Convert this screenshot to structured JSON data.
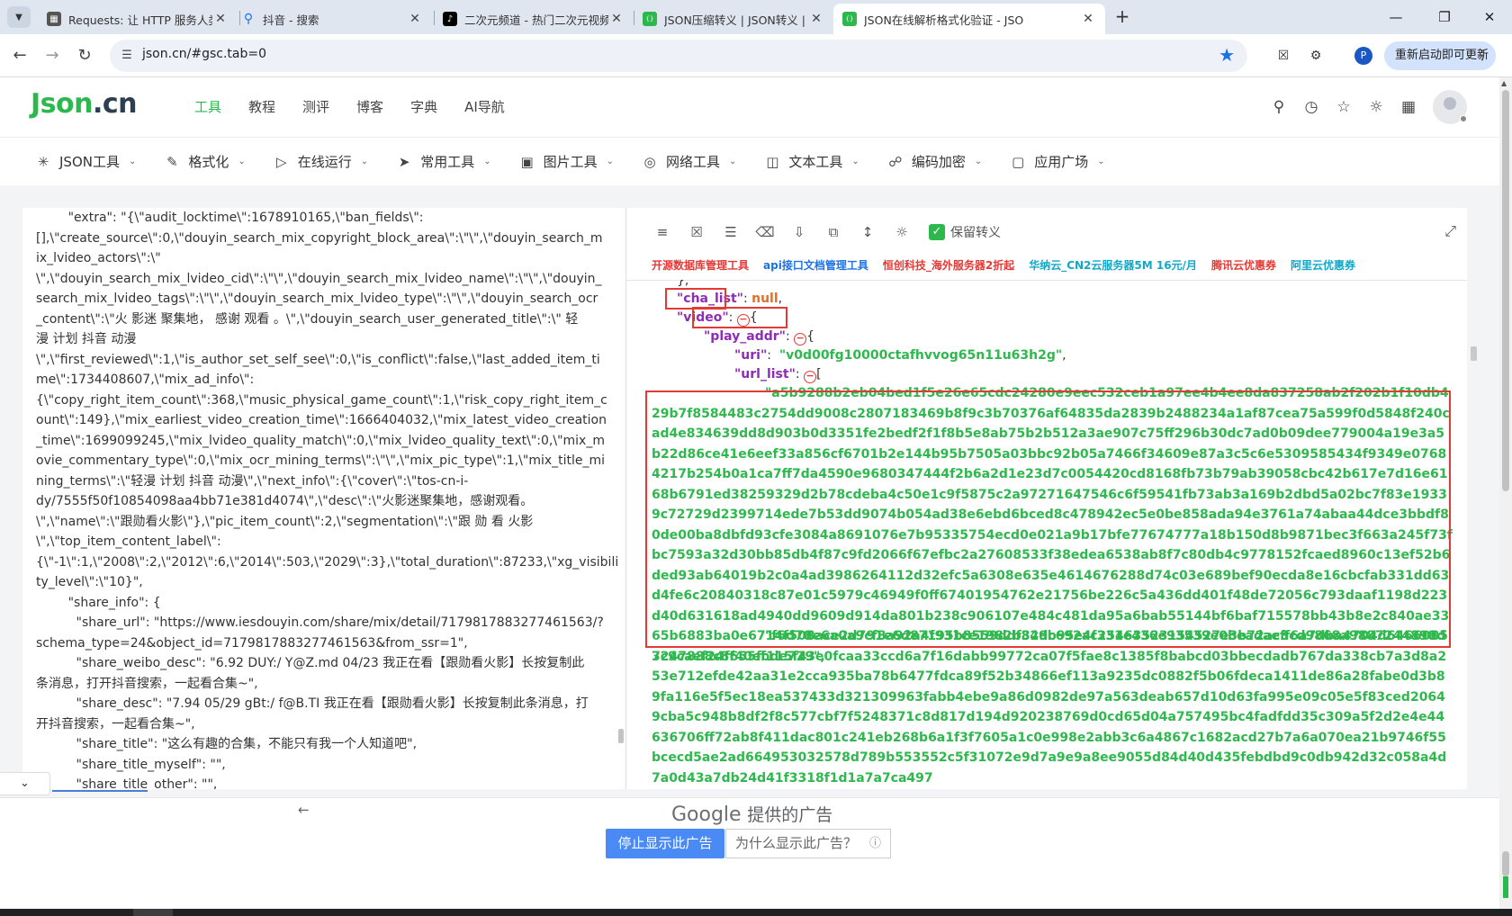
{
  "browser": {
    "tabs": [
      {
        "title": "Requests: 让 HTTP 服务人类 —",
        "favicon": "doc-icon",
        "color": "#555555"
      },
      {
        "title": "抖音 - 搜索",
        "favicon": "search-icon",
        "color": "#1a73e8"
      },
      {
        "title": "二次元频道 - 热门二次元视频大",
        "favicon": "tiktok-icon",
        "color": "#000000"
      },
      {
        "title": "JSON压缩转义 | JSON转义 | JS",
        "favicon": "json-icon",
        "color": "#2db84d"
      },
      {
        "title": "JSON在线解析格式化验证 - JSO",
        "favicon": "json-icon",
        "color": "#2db84d",
        "active": true
      }
    ],
    "url": "json.cn/#gsc.tab=0",
    "profile_initial": "P",
    "restart_label": "重新启动即可更新"
  },
  "site": {
    "logo_a": "Json",
    "logo_b": ".cn",
    "nav": [
      "工具",
      "教程",
      "测评",
      "博客",
      "字典",
      "AI导航"
    ],
    "active_nav": "工具",
    "subnav": [
      {
        "label": "JSON工具",
        "icon": "spark-icon"
      },
      {
        "label": "格式化",
        "icon": "brush-icon"
      },
      {
        "label": "在线运行",
        "icon": "play-icon"
      },
      {
        "label": "常用工具",
        "icon": "rocket-icon"
      },
      {
        "label": "图片工具",
        "icon": "image-icon"
      },
      {
        "label": "网络工具",
        "icon": "globe-icon"
      },
      {
        "label": "文本工具",
        "icon": "text-icon"
      },
      {
        "label": "编码加密",
        "icon": "lock-icon"
      },
      {
        "label": "应用广场",
        "icon": "app-icon"
      }
    ]
  },
  "editor": {
    "lines": [
      "        \"extra\": \"{\\\"audit_locktime\\\":1678910165,\\\"ban_fields\\\":",
      "[],\\\"create_source\\\":0,\\\"douyin_search_mix_copyright_block_area\\\":\\\"\\\",\\\"douyin_search_m",
      "ix_lvideo_actors\\\":\\\"",
      "\\\",\\\"douyin_search_mix_lvideo_cid\\\":\\\"\\\",\\\"douyin_search_mix_lvideo_name\\\":\\\"\\\",\\\"douyin_",
      "search_mix_lvideo_tags\\\":\\\"\\\",\\\"douyin_search_mix_lvideo_type\\\":\\\"\\\",\\\"douyin_search_ocr",
      "_content\\\":\\\"火 影迷 聚集地， 感谢 观看 。\\\",\\\"douyin_search_user_generated_title\\\":\\\" 轻",
      "漫 计划 抖音 动漫",
      "\\\",\\\"first_reviewed\\\":1,\\\"is_author_set_self_see\\\":0,\\\"is_conflict\\\":false,\\\"last_added_item_ti",
      "me\\\":1734408607,\\\"mix_ad_info\\\":",
      "{\\\"copy_right_item_count\\\":368,\\\"music_physical_game_count\\\":1,\\\"risk_copy_right_item_c",
      "ount\\\":149},\\\"mix_earliest_video_creation_time\\\":1666404032,\\\"mix_latest_video_creation",
      "_time\\\":1699099245,\\\"mix_lvideo_quality_match\\\":0,\\\"mix_lvideo_quality_text\\\":0,\\\"mix_m",
      "ovie_commentary_type\\\":0,\\\"mix_ocr_mining_terms\\\":\\\"\\\",\\\"mix_pic_type\\\":1,\\\"mix_title_mi",
      "ning_terms\\\":\\\"轻漫 计划 抖音 动漫\\\",\\\"next_info\\\":{\\\"cover\\\":\\\"tos-cn-i-",
      "dy/7555f50f10854098aa4bb71e381d4074\\\",\\\"desc\\\":\\\"火影迷聚集地，感谢观看。",
      "\\\",\\\"name\\\":\\\"跟勋看火影\\\"},\\\"pic_item_count\\\":2,\\\"segmentation\\\":\\\"跟 勋 看 火影",
      "\\\",\\\"top_item_content_label\\\":",
      "{\\\"-1\\\":1,\\\"2008\\\":2,\\\"2012\\\":6,\\\"2014\\\":503,\\\"2029\\\":3},\\\"total_duration\\\":87233,\\\"xg_visibili",
      "ty_level\\\":\\\"10}\",",
      "        \"share_info\": {",
      "          \"share_url\": \"https://www.iesdouyin.com/share/mix/detail/7179817883277461563/?",
      "schema_type=24&object_id=7179817883277461563&from_ssr=1\",",
      "          \"share_weibo_desc\": \"6.92 DUY:/ Y@Z.md 04/23 我正在看【跟勋看火影】长按复制此",
      "条消息，打开抖音搜索，一起看合集~\",",
      "          \"share_desc\": \"7.94 05/29 gBt:/ f@B.TI 我正在看【跟勋看火影】长按复制此条消息，打",
      "开抖音搜索，一起看合集~\",",
      "          \"share_title\": \"这么有趣的合集，不能只有我一个人知道吧\",",
      "          \"share_title_myself\": \"\",",
      "          \"share_title_other\": \"\","
    ]
  },
  "viewer": {
    "keep_escape_label": "保留转义",
    "ad_links": [
      {
        "text": "开源数据库管理工具",
        "color": "#e53935"
      },
      {
        "text": "api接口文档管理工具",
        "color": "#1a73e8"
      },
      {
        "text": "恒创科技_海外服务器2折起",
        "color": "#e53935"
      },
      {
        "text": "华纳云_CN2云服务器5M 16元/月",
        "color": "#10a8c8"
      },
      {
        "text": "腾讯云优惠券",
        "color": "#e53935"
      },
      {
        "text": "阿里云优惠券",
        "color": "#10a8c8"
      }
    ],
    "tree": {
      "close_brace": "},",
      "cha_list_key": "\"cha_list\"",
      "cha_list_val": "null",
      "video_key": "\"video\"",
      "play_addr_key": "\"play_addr\"",
      "uri_key": "\"uri\"",
      "uri_val": "\"v0d00fg10000ctafhvvog65n11u63h2g\"",
      "url_list_key": "\"url_list\"",
      "url1": "\"a5b9288b2eb04bed1f5e26e65cdc24280e9eec532ceb1a97ee4b4ee8da837258ab2f202b1f10db429b7f8584483c2754dd9008c2807183469b8f9c3b70376af64835da2839b2488234a1af87cea75a599f0d5848f240cad4e834639dd8d903b0d3351fe2bedf2f1f8b5e8ab75b2b512a3ae907c75ff296b30dc7ad0b09dee779004a19e3a5b22d86ce41e6eef33a856cf6701b2e144b95b7505a03bbc92b05a7466f34609e87a3c5c6e5309585434f9349e07684217b254b0a1ca7ff7da4590e9680347444f2b6a2d1e23d7c0054420cd8168fb73b79ab39058cbc42b617e7d16e6168b6791ed38259329d2b78cdeba4c50e1c9f5875c2a97271647546c6f59541fb73ab3a169b2dbd5a02bc7f83e19339c72729d2399714ede7b53dd9074b054ad38e6ebd6bced8c478942ec5e0be858ada94e3761a74abaa44dce3bbdf80de00ba8dbfd93cfe3084a8691076e7b95335754ecd0e021a9b17bfe77674777a18b150d8b9871bec3f663a245f73fbc7593a32d30bb85db4f87c9fd2066f67efbc2a27608533f38edea6538ab8f7c80db4c9778152fcaed8960c13ef52b6ded93ab64019b2c0a4ad3986264112d32efc5a6308e635e4614676288d74c03e689bef90ecda8e16cbcfab331dd63d4fe6c20840318c87e01c5979c46949f0ff67401954762e21756be226c5a436dd401f48de72056c793daaf1198d223d40d631618ad4940dd9609d914da801b238c906107e484c481da95a6bab55144bf6baf715578bb43b8e2c840ae3365b6883ba0e6714f508ace2d791e6d87195b8559ddf82dc692ac25463523154527e3b72ac3cd9868a9887244898d3247888c8f40ebde729\",",
      "url2": "\"f6d78e6a0a9cf8a92a4f931ce1982b349b95e4f331e436e93539e0beadaeff6a7dba4704d64660857c9caef24f655ff115f43e0fcaa33ccd6a7f16dabb99772ca07f5fae8c1385f8babcd03bbecdadb767da338cb7a3d8a253e712efde42aa31e2cca935ba78b6477fdca89f52b34866ef113a9235dc0882f5b06fdeca1411de86a28fabe0d3b89fa116e5f5ec18ea537433d321309963fabb4ebe9a86d0982de97a563deab657d10d63fa995e09c05e5f83ced20649cba5c948b8df2f8c577cbf7f5248371c8d817d194d920238769d0cd65d04a757495bc4fadfdd35c309a5f2d2e4e44636706ff72ab8f411dac801c241eb268b6a1f3f7605a1c0e998e2abb3c6a4867c1682acd27b7a6a070ea21b9746f55bcecd5ae2ad664953032578d789b553552c5f31072e9d7a9e9a8ee9055d84d40d435febdbd9c0db942d32c058a4d7a0d43a7db24d41f3318f1d1a7a7ca497"
    }
  },
  "ad": {
    "google_label": "Google",
    "provided_label": "提供的广告",
    "stop_label": "停止显示此广告",
    "why_label": "为什么显示此广告？"
  }
}
